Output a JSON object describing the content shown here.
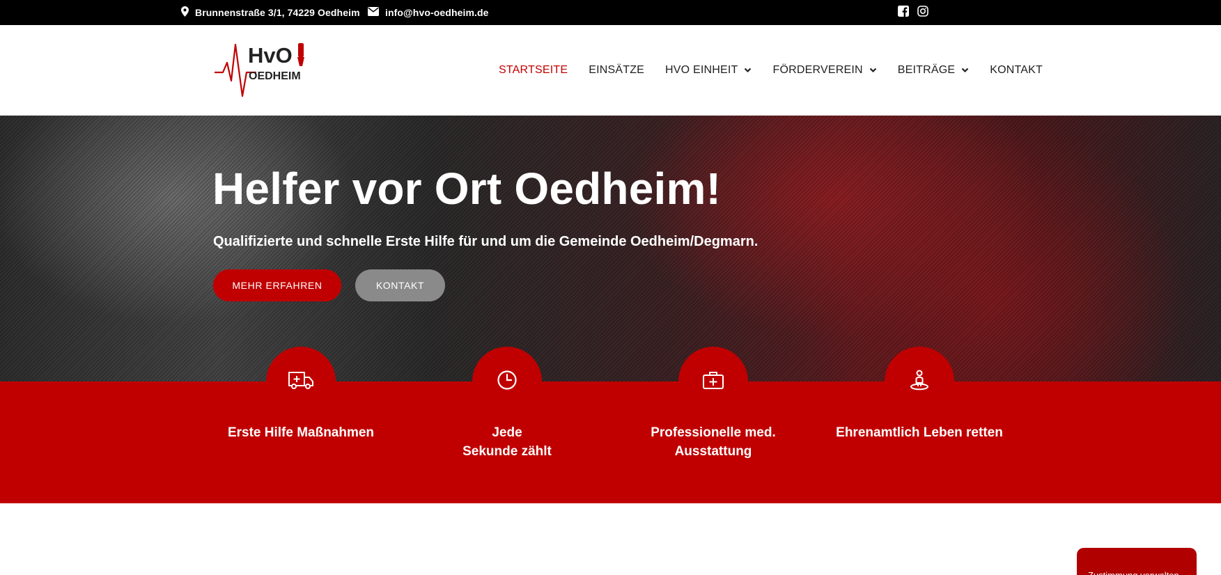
{
  "topbar": {
    "address": "Brunnenstraße 3/1, 74229 Oedheim",
    "email": "info@hvo-oedheim.de",
    "social_icons": [
      "facebook-icon",
      "instagram-icon"
    ]
  },
  "logo": {
    "line1": "HvO",
    "line2": "OEDHEIM"
  },
  "nav": {
    "items": [
      {
        "label": "STARTSEITE",
        "active": true,
        "dropdown": false
      },
      {
        "label": "EINSÄTZE",
        "active": false,
        "dropdown": false
      },
      {
        "label": "HVO EINHEIT",
        "active": false,
        "dropdown": true
      },
      {
        "label": "FÖRDERVEREIN",
        "active": false,
        "dropdown": true
      },
      {
        "label": "BEITRÄGE",
        "active": false,
        "dropdown": true
      },
      {
        "label": "KONTAKT",
        "active": false,
        "dropdown": false
      }
    ]
  },
  "hero": {
    "title": "Helfer vor Ort Oedheim!",
    "subtitle": "Qualifizierte und schnelle Erste Hilfe für und um die Gemeinde Oedheim/Degmarn.",
    "primary_button": "MEHR ERFAHREN",
    "secondary_button": "KONTAKT"
  },
  "features": [
    {
      "icon": "ambulance-icon",
      "label": "Erste Hilfe Maßnahmen"
    },
    {
      "icon": "clock-icon",
      "label": "Jede\nSekunde zählt"
    },
    {
      "icon": "first-aid-kit-icon",
      "label": "Professionelle med.\nAusstattung"
    },
    {
      "icon": "volunteer-person-icon",
      "label": "Ehrenamtlich Leben retten"
    }
  ],
  "cookie": {
    "label": "Zustimmung verwalten"
  },
  "colors": {
    "accent": "#c00000",
    "topbar": "#000000",
    "secondary_button": "#8a8a8a"
  }
}
